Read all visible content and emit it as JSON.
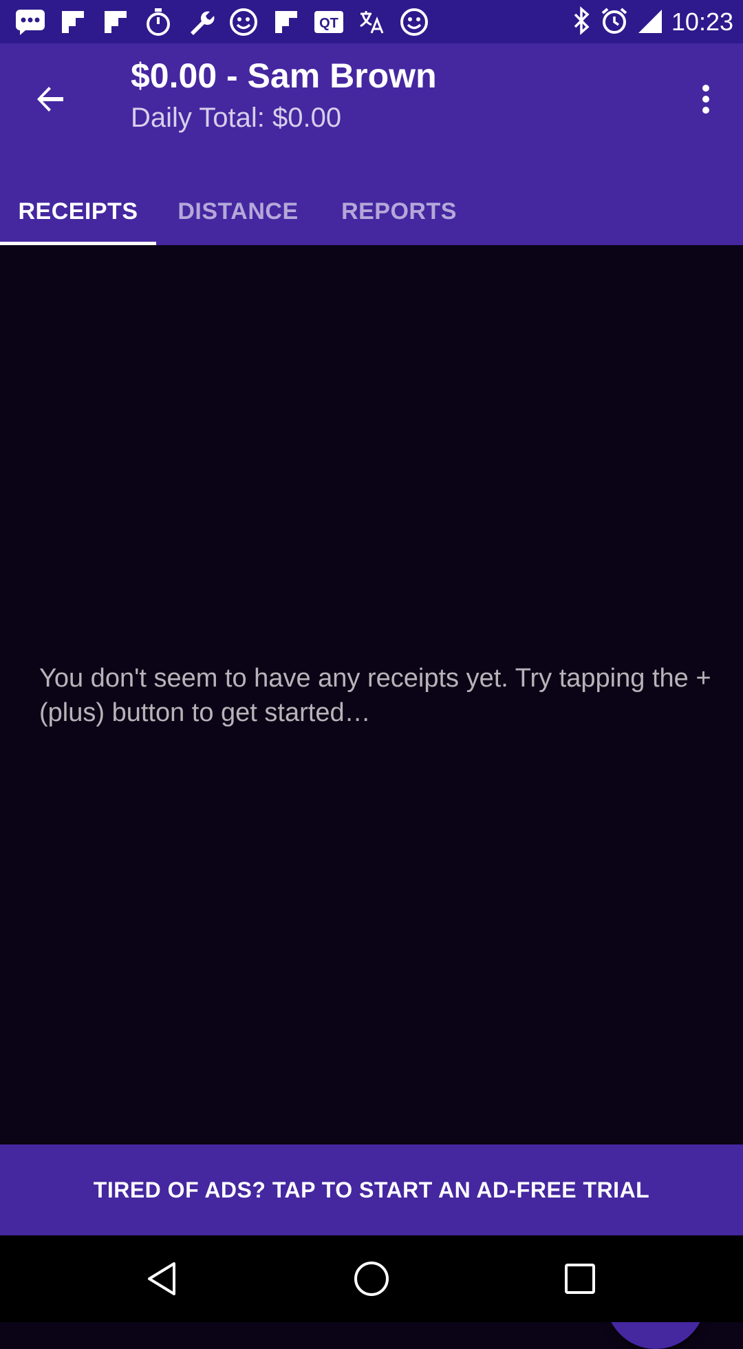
{
  "status_bar": {
    "time": "10:23",
    "notification_icons": [
      "chat-icon",
      "flipboard-icon",
      "flipboard-icon",
      "stopwatch-icon",
      "wrench-icon",
      "smiley-icon",
      "flipboard-icon",
      "qr-icon",
      "translate-icon",
      "smiley-icon"
    ],
    "system_icons": [
      "bluetooth-icon",
      "alarm-icon",
      "signal-icon"
    ]
  },
  "app_bar": {
    "title": "$0.00 - Sam Brown",
    "subtitle": "Daily Total: $0.00",
    "tabs": [
      {
        "label": "RECEIPTS",
        "active": true
      },
      {
        "label": "DISTANCE",
        "active": false
      },
      {
        "label": "REPORTS",
        "active": false
      }
    ]
  },
  "content": {
    "empty_message": "You don't seem to have any receipts yet. Try tapping the + (plus) button to get started…"
  },
  "ad_banner": {
    "text": "TIRED OF ADS? TAP TO START AN AD-FREE TRIAL"
  },
  "colors": {
    "primary": "#4527a0",
    "status_bar": "#2e1a8c",
    "background": "#0b0416"
  }
}
